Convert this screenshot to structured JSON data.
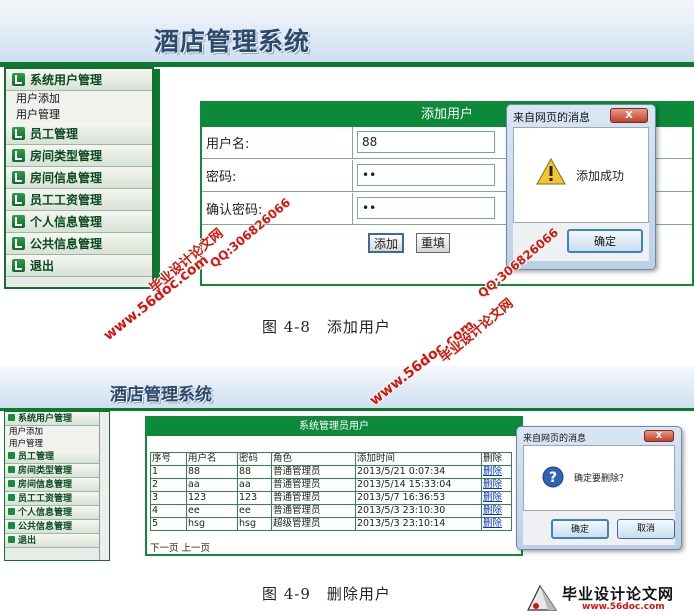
{
  "shot1": {
    "app_title": "酒店管理系统",
    "menu": [
      {
        "label": "系统用户管理",
        "subitems": [
          "用户添加",
          "用户管理"
        ]
      },
      {
        "label": "员工管理"
      },
      {
        "label": "房间类型管理"
      },
      {
        "label": "房间信息管理"
      },
      {
        "label": "员工工资管理"
      },
      {
        "label": "个人信息管理"
      },
      {
        "label": "公共信息管理"
      },
      {
        "label": "退出"
      }
    ],
    "form": {
      "title": "添加用户",
      "username_label": "用户名:",
      "username_value": "88",
      "password_label": "密码:",
      "password_value": "••",
      "confirm_label": "确认密码:",
      "confirm_value": "••",
      "add_button": "添加",
      "reset_button": "重填"
    },
    "dialog": {
      "title": "来自网页的消息",
      "close": "X",
      "message": "添加成功",
      "ok_button": "确定"
    }
  },
  "caption1": "图 4-8　添加用户",
  "shot2": {
    "app_title": "酒店管理系统",
    "menu": [
      {
        "label": "系统用户管理",
        "subitems": [
          "用户添加",
          "用户管理"
        ]
      },
      {
        "label": "员工管理"
      },
      {
        "label": "房间类型管理"
      },
      {
        "label": "房间信息管理"
      },
      {
        "label": "员工工资管理"
      },
      {
        "label": "个人信息管理"
      },
      {
        "label": "公共信息管理"
      },
      {
        "label": "退出"
      }
    ],
    "panel_title": "系统管理员用户",
    "table": {
      "headers": [
        "序号",
        "用户名",
        "密码",
        "角色",
        "添加时间",
        "删除"
      ],
      "rows": [
        [
          "1",
          "88",
          "88",
          "普通管理员",
          "2013/5/21 0:07:34",
          "删除"
        ],
        [
          "2",
          "aa",
          "aa",
          "普通管理员",
          "2013/5/14 15:33:04",
          "删除"
        ],
        [
          "3",
          "123",
          "123",
          "普通管理员",
          "2013/5/7 16:36:53",
          "删除"
        ],
        [
          "4",
          "ee",
          "ee",
          "普通管理员",
          "2013/5/3 23:10:30",
          "删除"
        ],
        [
          "5",
          "hsg",
          "hsg",
          "超级管理员",
          "2013/5/3 23:10:14",
          "删除"
        ]
      ]
    },
    "pager": "下一页 上一页",
    "dialog": {
      "title": "来自网页的消息",
      "close": "X",
      "message": "确定要删除？",
      "ok_button": "确定",
      "cancel_button": "取消"
    }
  },
  "caption2": "图 4-9　删除用户",
  "watermarks": {
    "site": "www.56doc.com",
    "qq": "QQ:306826066",
    "brand": "毕业设计论文网"
  },
  "logo": {
    "text": "毕业设计论文网",
    "url": "www.56doc.com"
  },
  "colors": {
    "accent": "#0c8a3a",
    "watermark": "#d8140b",
    "link": "#0b33c8"
  }
}
